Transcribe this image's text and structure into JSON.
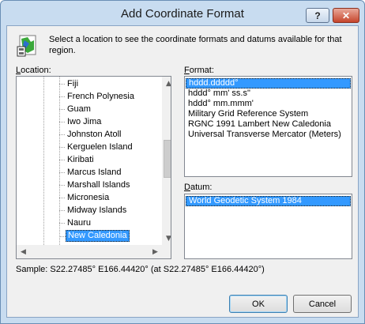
{
  "window": {
    "title": "Add Coordinate Format",
    "help_glyph": "?",
    "close_glyph": "✕"
  },
  "intro_text": "Select a location to see the coordinate formats and datums available for that region.",
  "location": {
    "label_underlined": "L",
    "label_rest": "ocation:",
    "items": [
      "Fiji",
      "French Polynesia",
      "Guam",
      "Iwo Jima",
      "Johnston Atoll",
      "Kerguelen Island",
      "Kiribati",
      "Marcus Island",
      "Marshall Islands",
      "Micronesia",
      "Midway Islands",
      "Nauru",
      "New Caledonia"
    ],
    "selected": "New Caledonia"
  },
  "format": {
    "label_underlined": "F",
    "label_rest": "ormat:",
    "items": [
      "hddd.ddddd°",
      "hddd° mm' ss.s\"",
      "hddd° mm.mmm'",
      "Military Grid Reference System",
      "RGNC 1991 Lambert New Caledonia",
      "Universal Transverse Mercator (Meters)"
    ],
    "selected": "hddd.ddddd°"
  },
  "datum": {
    "label_underlined": "D",
    "label_rest": "atum:",
    "items": [
      "World Geodetic System 1984"
    ],
    "selected": "World Geodetic System 1984"
  },
  "sample_text": "Sample: S22.27485° E166.44420° (at S22.27485° E166.44420°)",
  "buttons": {
    "ok": "OK",
    "cancel": "Cancel"
  },
  "scroll_glyphs": {
    "up": "▲",
    "down": "▼",
    "left": "◀",
    "right": "▶"
  },
  "icon": "map-icon"
}
